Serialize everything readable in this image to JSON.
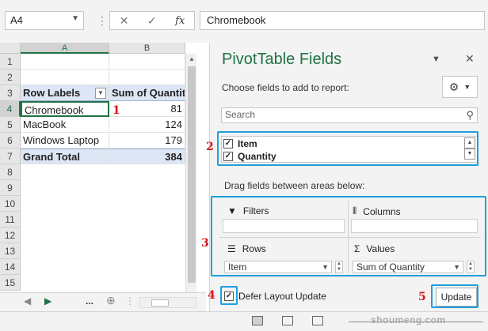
{
  "formula_bar": {
    "name_box": "A4",
    "cancel_icon": "✕",
    "enter_icon": "✓",
    "fx_label": "fx",
    "content": "Chromebook"
  },
  "sheet": {
    "columns": [
      "A",
      "B"
    ],
    "row_numbers": [
      "1",
      "2",
      "3",
      "4",
      "5",
      "6",
      "7",
      "8",
      "9",
      "10",
      "11",
      "12",
      "13",
      "14",
      "15"
    ],
    "pivot_header": {
      "row_labels": "Row Labels",
      "sum_of_quantity": "Sum of Quantity"
    },
    "rows": [
      {
        "label": "Chromebook",
        "value": "81"
      },
      {
        "label": "MacBook",
        "value": "124"
      },
      {
        "label": "Windows Laptop",
        "value": "179"
      }
    ],
    "grand_total": {
      "label": "Grand Total",
      "value": "384"
    },
    "ellipsis": "..."
  },
  "annotations": [
    "1",
    "2",
    "3",
    "4",
    "5"
  ],
  "pivot_pane": {
    "title": "PivotTable Fields",
    "choose_text": "Choose fields to add to report:",
    "search_placeholder": "Search",
    "fields": [
      {
        "label": "Item",
        "checked": true
      },
      {
        "label": "Quantity",
        "checked": true
      }
    ],
    "drag_text": "Drag fields between areas below:",
    "areas": {
      "filters": "Filters",
      "columns": "Columns",
      "rows": "Rows",
      "values": "Values",
      "rows_item": "Item",
      "values_item": "Sum of Quantity"
    },
    "defer_label": "Defer Layout Update",
    "defer_checked": true,
    "update_label": "Update"
  },
  "watermark": "shoumeng.com",
  "colors": {
    "excel_green": "#217346",
    "highlight_blue": "#1e9fdc",
    "annotation_red": "#d4141b",
    "pivot_header_fill": "#dce6f4"
  }
}
